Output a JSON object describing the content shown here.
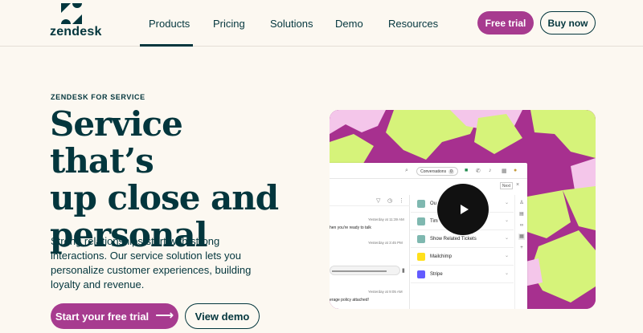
{
  "brand": {
    "name": "zendesk"
  },
  "nav": {
    "items": [
      {
        "label": "Products",
        "active": true
      },
      {
        "label": "Pricing",
        "active": false
      },
      {
        "label": "Solutions",
        "active": false
      },
      {
        "label": "Demo",
        "active": false
      },
      {
        "label": "Resources",
        "active": false
      }
    ],
    "free_trial": "Free trial",
    "buy_now": "Buy now"
  },
  "hero": {
    "eyebrow": "ZENDESK FOR SERVICE",
    "title_line1": "Service that’s",
    "title_line2": "up close and",
    "title_line3": "personal",
    "body": "Strong relationships start with strong interactions. Our service solution lets you personalize customer experiences, building loyalty and revenue.",
    "cta_primary": "Start your free trial",
    "cta_secondary": "View demo"
  },
  "media": {
    "app": {
      "conversations_label": "Conversations",
      "conversations_count": "0",
      "next_label": "Next",
      "messages": [
        {
          "meta": "Yesterday at 11:39 AM",
          "text": "hen you're ready to talk"
        },
        {
          "meta": "Yesterday at 3:45 PM",
          "text": ""
        },
        {
          "meta": "Yesterday at 9:05 AM",
          "text": "erage policy attached!"
        }
      ],
      "apps": [
        {
          "label": "Ou",
          "color": "#7fb8b0"
        },
        {
          "label": "Tim",
          "color": "#7fb8b0"
        },
        {
          "label": "Show Related Tickets",
          "color": "#7fb8b0"
        },
        {
          "label": "Mailchimp",
          "color": "#ffe01b"
        },
        {
          "label": "Stripe",
          "color": "#635bff"
        }
      ]
    }
  },
  "colors": {
    "accent": "#a73b8f",
    "ink": "#03363d",
    "background": "#fcf8f1",
    "lime": "#d6f37a",
    "pink": "#f4c6ea"
  }
}
